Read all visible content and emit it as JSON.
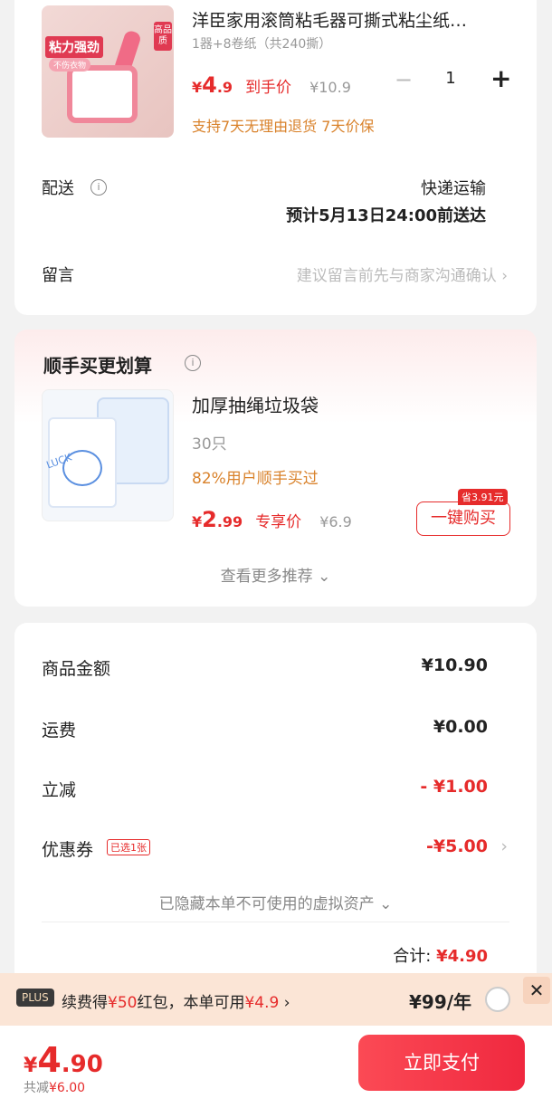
{
  "product": {
    "thumb_text_1": "粘力强劲",
    "thumb_text_2": "不伤衣物",
    "thumb_text_3": "高品质",
    "title": "洋臣家用滚筒粘毛器可撕式粘尘纸…",
    "spec": "1器+8卷纸（共240撕）",
    "currency": "¥",
    "price_int": "4",
    "price_dec": ".9",
    "price_tag": "到手价",
    "original_price": "¥10.9",
    "qty_minus": "−",
    "quantity": "1",
    "qty_plus": "+",
    "guarantee": "支持7天无理由退货  7天价保"
  },
  "delivery": {
    "label": "配送",
    "info_icon": "info-icon",
    "method": "快递运输",
    "eta": "预计5月13日24:00前送达"
  },
  "note": {
    "label": "留言",
    "placeholder": "建议留言前先与商家沟通确认",
    "chevron": "›"
  },
  "recommend": {
    "section_title": "顺手买更划算",
    "thumb_text": "LUCK",
    "item_name": "加厚抽绳垃圾袋",
    "item_qty": "30只",
    "buy_rate": "82%用户顺手买过",
    "currency": "¥",
    "price_int": "2",
    "price_dec": ".99",
    "price_tag": "专享价",
    "original_price": "¥6.9",
    "save_badge": "省3.91元",
    "buy_button": "一键购买",
    "see_more": "查看更多推荐 ⌄"
  },
  "summary": {
    "goods_label": "商品金额",
    "goods_value": "¥10.90",
    "shipping_label": "运费",
    "shipping_value": "¥0.00",
    "discount_label": "立减",
    "discount_value": "- ¥1.00",
    "coupon_label": "优惠券",
    "coupon_badge": "已选1张",
    "coupon_value": "-¥5.00",
    "coupon_chevron": "›",
    "hidden_assets": "已隐藏本单不可使用的虚拟资产 ⌄",
    "total_label": "合计:",
    "total_value": "¥4.90"
  },
  "plus": {
    "badge": "PLUS",
    "text_1": "续费得",
    "text_red_1": "¥50",
    "text_2": "红包，本单可用",
    "text_red_2": "¥4.9",
    "text_3": " ›",
    "price": "¥99/年",
    "close": "✕"
  },
  "bottom": {
    "currency": "¥",
    "pay_int": "4",
    "pay_dec": ".90",
    "saved_label": "共减",
    "saved_value": "¥6.00",
    "pay_button": "立即支付"
  },
  "colors": {
    "accent_red": "#e62b2b",
    "accent_orange": "#d9822b",
    "plus_banner": "#fbe5d6"
  }
}
